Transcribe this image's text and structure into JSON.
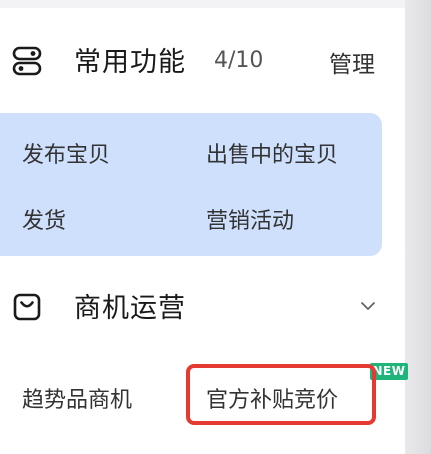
{
  "common_functions": {
    "title": "常用功能",
    "count": "4/10",
    "manage_label": "管理",
    "icon": "toggle-switches-icon",
    "items": [
      {
        "label": "发布宝贝"
      },
      {
        "label": "出售中的宝贝"
      },
      {
        "label": "发货"
      },
      {
        "label": "营销活动"
      }
    ],
    "panel_color": "#cfe0fd"
  },
  "business_ops": {
    "title": "商机运营",
    "icon": "shopping-bag-icon",
    "chevron_icon": "chevron-down-icon",
    "items": [
      {
        "label": "趋势品商机"
      },
      {
        "label": "官方补贴竞价",
        "badge": "NEW"
      }
    ],
    "badge_color": "#1fb57a"
  },
  "highlight_color": "#e53a32"
}
